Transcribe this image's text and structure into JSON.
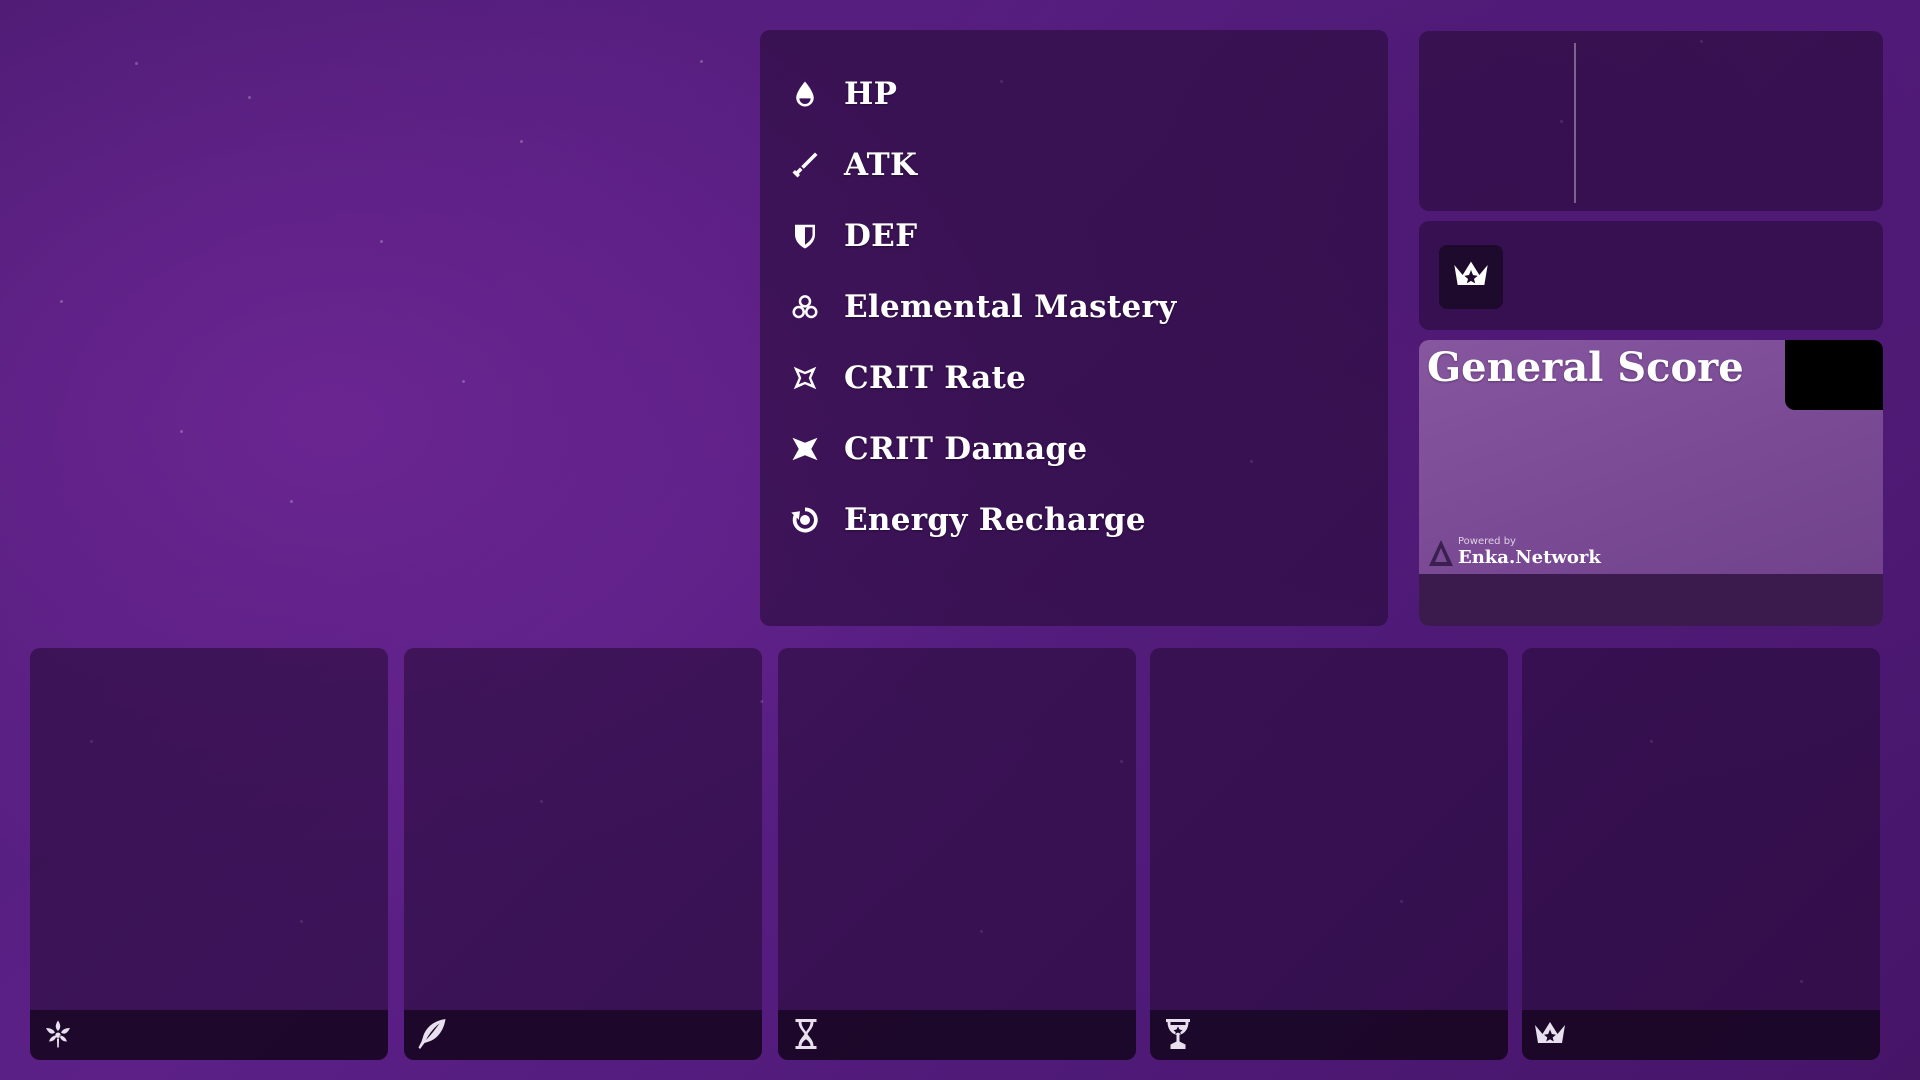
{
  "stats": [
    {
      "label": "HP",
      "icon": "hp-drop-icon"
    },
    {
      "label": "ATK",
      "icon": "atk-sword-icon"
    },
    {
      "label": "DEF",
      "icon": "def-shield-icon"
    },
    {
      "label": "Elemental Mastery",
      "icon": "elemental-mastery-icon"
    },
    {
      "label": "CRIT Rate",
      "icon": "crit-rate-icon"
    },
    {
      "label": "CRIT Damage",
      "icon": "crit-damage-icon"
    },
    {
      "label": "Energy Recharge",
      "icon": "energy-recharge-icon"
    }
  ],
  "set_bonus": {
    "icon": "circlet-crown-icon"
  },
  "score": {
    "title": "General Score",
    "powered_by": "Powered by",
    "brand": "Enka.Network"
  },
  "artifacts": [
    {
      "slot_icon": "flower-icon"
    },
    {
      "slot_icon": "plume-icon"
    },
    {
      "slot_icon": "sands-hourglass-icon"
    },
    {
      "slot_icon": "goblet-icon"
    },
    {
      "slot_icon": "circlet-icon"
    }
  ],
  "colors": {
    "background": "#5a1e86",
    "panel": "#2a0c3c",
    "score_panel": "#7c4c97",
    "score_footer": "#3b1a4d",
    "text": "#ffffff"
  }
}
